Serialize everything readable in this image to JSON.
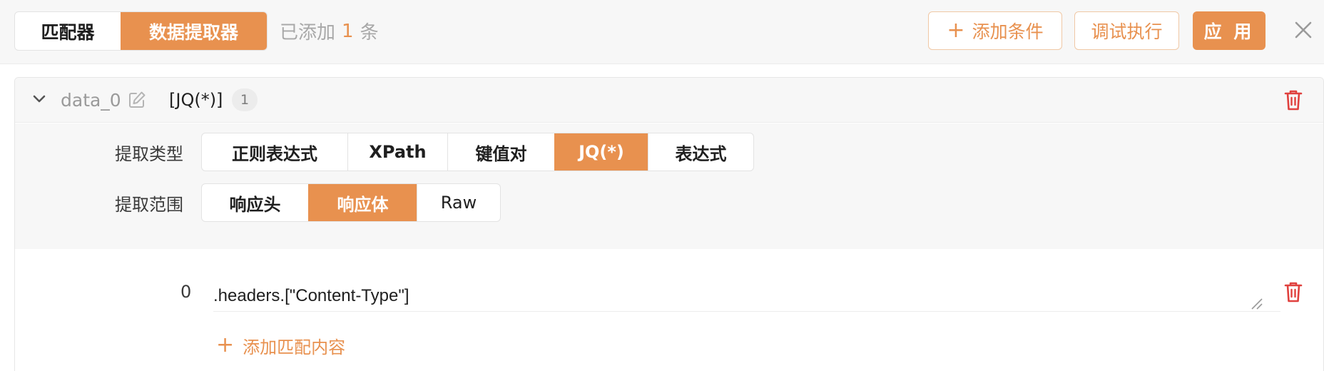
{
  "topbar": {
    "tabs": [
      {
        "label": "匹配器",
        "active": false
      },
      {
        "label": "数据提取器",
        "active": true
      }
    ],
    "added_prefix": "已添加",
    "added_count": "1",
    "added_suffix": "条",
    "add_condition_icon": "plus-icon",
    "add_condition_label": "添加条件",
    "debug_label": "调试执行",
    "apply_label": "应 用",
    "close_icon": "close-icon"
  },
  "extractor": {
    "name": "data_0",
    "type_tag": "[JQ(*)]",
    "badge_count": "1",
    "extract_type_label": "提取类型",
    "extract_types": [
      "正则表达式",
      "XPath",
      "键值对",
      "JQ(*)",
      "表达式"
    ],
    "extract_type_selected": "JQ(*)",
    "extract_scope_label": "提取范围",
    "extract_scopes": [
      "响应头",
      "响应体",
      "Raw"
    ],
    "extract_scope_selected": "响应体",
    "rules": [
      {
        "index": "0",
        "value": ".headers.[\"Content-Type\"]"
      }
    ],
    "add_match_label": "添加匹配内容"
  },
  "colors": {
    "accent": "#e8914f",
    "danger": "#e0413e",
    "muted": "#a8a8a8"
  }
}
